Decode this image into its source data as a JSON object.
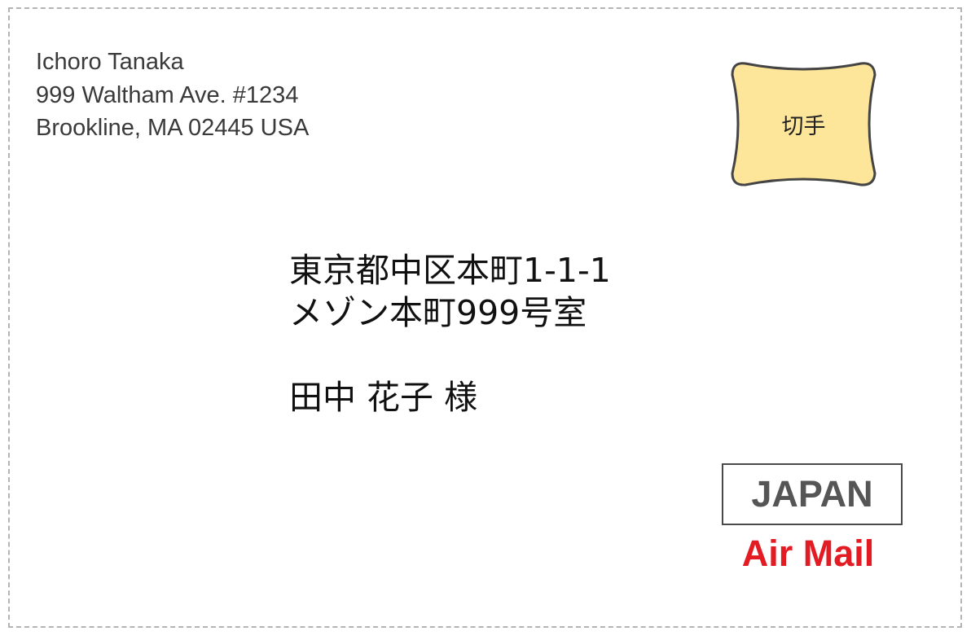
{
  "sender": {
    "lines": [
      "Ichoro Tanaka",
      "999 Waltham Ave. #1234",
      "Brookline, MA 02445 USA"
    ]
  },
  "stamp": {
    "label": "切手",
    "fill_color": "#fde59a",
    "border_color": "#444444"
  },
  "recipient": {
    "address_lines": [
      "東京都中区本町1-1-1",
      "メゾン本町999号室"
    ],
    "name": "田中 花子 様"
  },
  "country": "JAPAN",
  "airmail": {
    "label": "Air Mail",
    "color": "#e31b23"
  }
}
